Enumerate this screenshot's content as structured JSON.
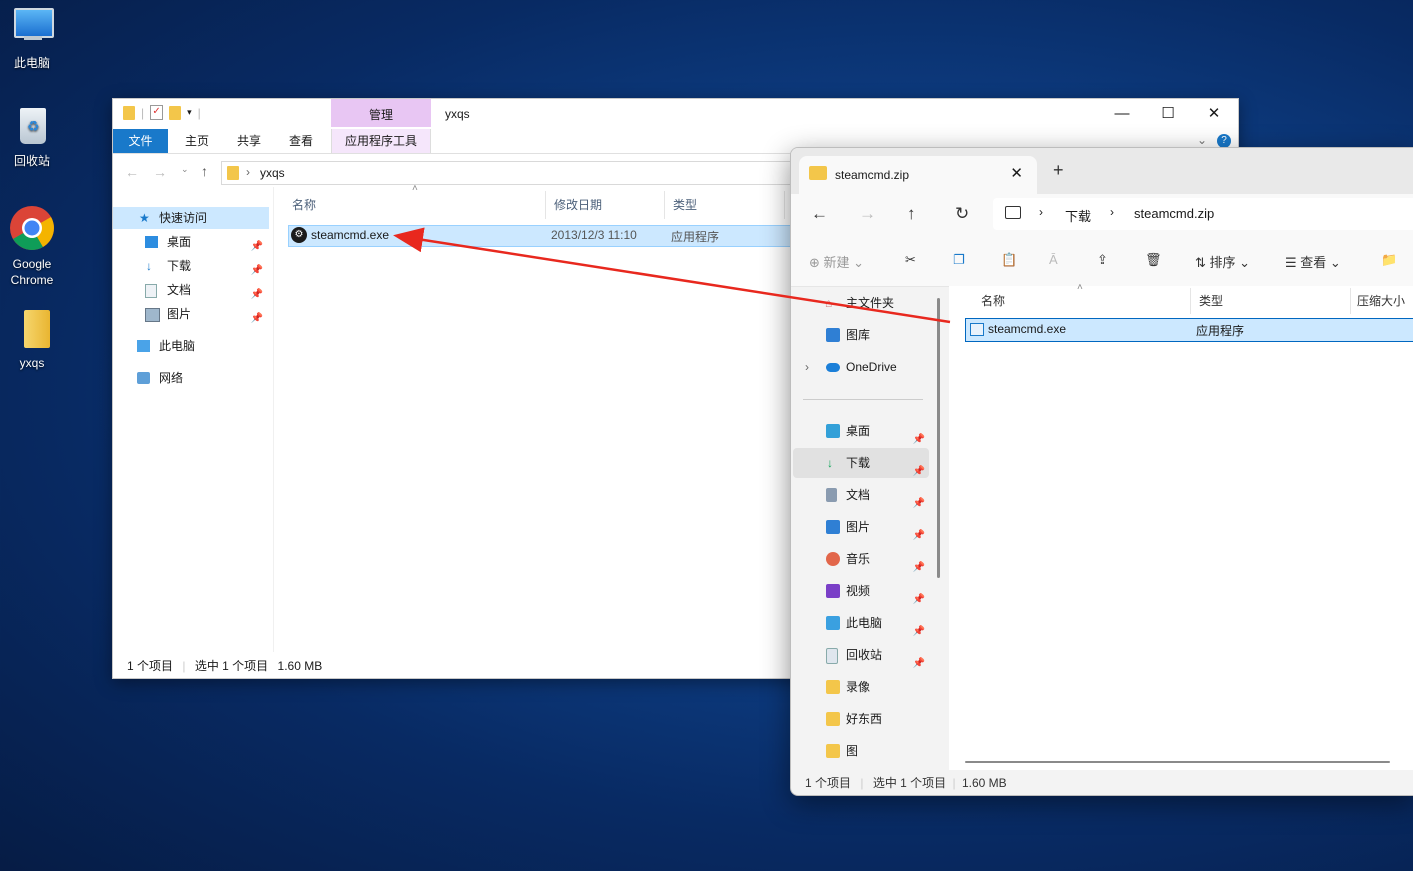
{
  "desktop": {
    "icons": [
      {
        "label": "此电脑"
      },
      {
        "label": "回收站"
      },
      {
        "label": "Google Chrome"
      },
      {
        "label": "yxqs"
      }
    ]
  },
  "win10": {
    "title": "yxqs",
    "context_tab": "管理",
    "tabs": {
      "file": "文件",
      "home": "主页",
      "share": "共享",
      "view": "查看",
      "app_tools": "应用程序工具"
    },
    "path": {
      "current": "yxqs"
    },
    "nav": {
      "quick_access": "快速访问",
      "desktop": "桌面",
      "downloads": "下载",
      "documents": "文档",
      "pictures": "图片",
      "this_pc": "此电脑",
      "network": "网络"
    },
    "columns": {
      "name": "名称",
      "modified": "修改日期",
      "type": "类型"
    },
    "file": {
      "name": "steamcmd.exe",
      "modified": "2013/12/3 11:10",
      "type": "应用程序"
    },
    "status": {
      "count": "1 个项目",
      "selected": "选中 1 个项目",
      "size": "1.60 MB"
    }
  },
  "win11": {
    "tab_title": "steamcmd.zip",
    "path": {
      "seg1": "下载",
      "seg2": "steamcmd.zip"
    },
    "commands": {
      "new": "新建",
      "sort": "排序",
      "view": "查看"
    },
    "side": {
      "home": "主文件夹",
      "gallery": "图库",
      "onedrive": "OneDrive",
      "desktop": "桌面",
      "downloads": "下载",
      "documents": "文档",
      "pictures": "图片",
      "music": "音乐",
      "videos": "视频",
      "this_pc": "此电脑",
      "recycle": "回收站",
      "recordings": "录像",
      "goodstuff": "好东西",
      "pics": "图"
    },
    "columns": {
      "name": "名称",
      "type": "类型",
      "compressed": "压缩大小"
    },
    "file": {
      "name": "steamcmd.exe",
      "type": "应用程序"
    },
    "status": {
      "count": "1 个项目",
      "selected": "选中 1 个项目",
      "size": "1.60 MB"
    }
  },
  "colors": {
    "accent": "#1979ca",
    "selection": "#cce8ff",
    "arrow": "#e8281e"
  }
}
